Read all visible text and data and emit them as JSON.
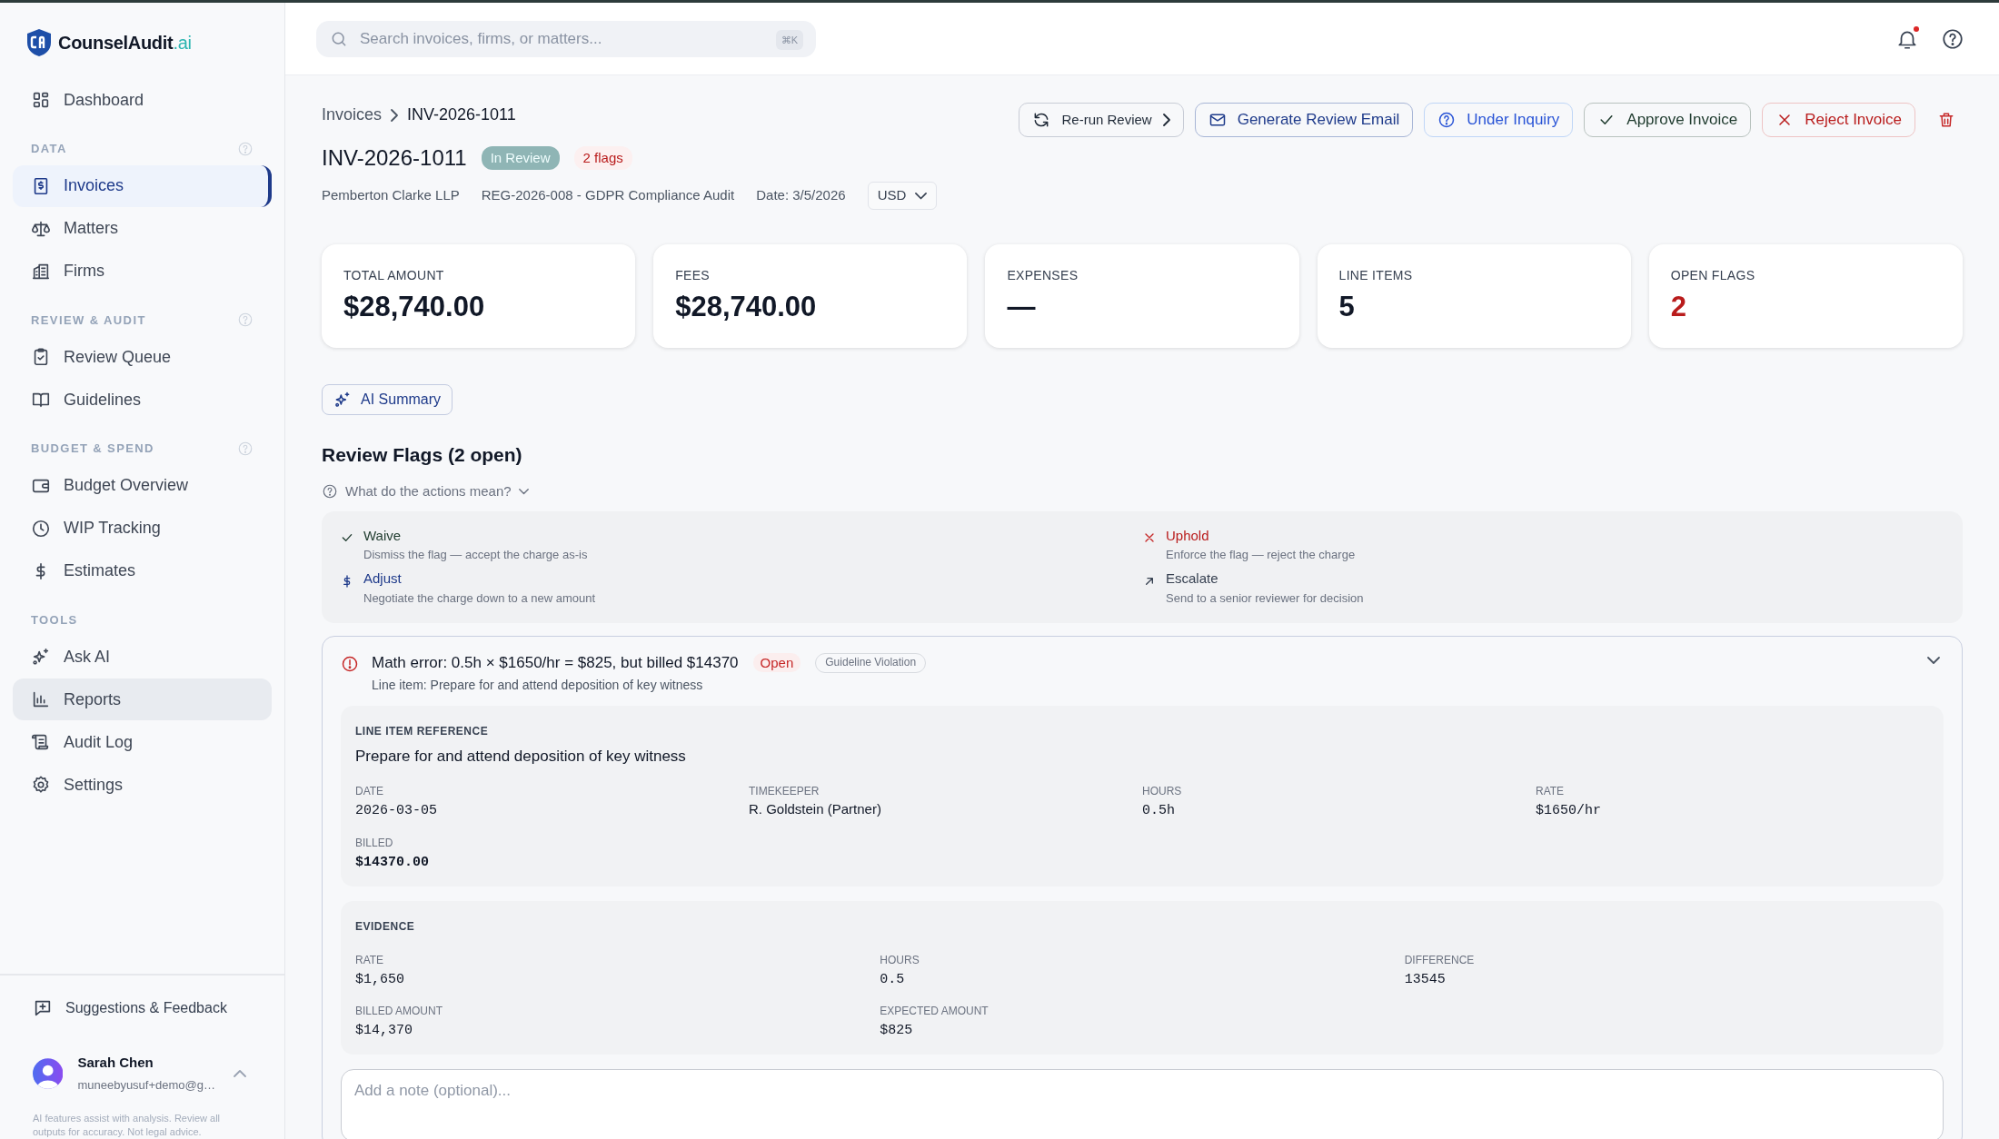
{
  "brand": {
    "name": "CounselAudit",
    "suffix": ".ai"
  },
  "sidebar": {
    "top_items": [
      {
        "label": "Dashboard",
        "selected": false,
        "hovered": false
      }
    ],
    "sections": [
      {
        "title": "DATA",
        "help": true,
        "items": [
          {
            "label": "Invoices",
            "selected": true,
            "hovered": false
          },
          {
            "label": "Matters",
            "selected": false,
            "hovered": false
          },
          {
            "label": "Firms",
            "selected": false,
            "hovered": false
          }
        ]
      },
      {
        "title": "REVIEW & AUDIT",
        "help": true,
        "items": [
          {
            "label": "Review Queue",
            "selected": false,
            "hovered": false
          },
          {
            "label": "Guidelines",
            "selected": false,
            "hovered": false
          }
        ]
      },
      {
        "title": "BUDGET & SPEND",
        "help": true,
        "items": [
          {
            "label": "Budget Overview",
            "selected": false,
            "hovered": false
          },
          {
            "label": "WIP Tracking",
            "selected": false,
            "hovered": false
          },
          {
            "label": "Estimates",
            "selected": false,
            "hovered": false
          }
        ]
      },
      {
        "title": "TOOLS",
        "help": false,
        "items": [
          {
            "label": "Ask AI",
            "selected": false,
            "hovered": false
          },
          {
            "label": "Reports",
            "selected": false,
            "hovered": true
          },
          {
            "label": "Audit Log",
            "selected": false,
            "hovered": false
          },
          {
            "label": "Settings",
            "selected": false,
            "hovered": false
          }
        ]
      }
    ],
    "feedback": "Suggestions & Feedback",
    "user": {
      "name": "Sarah Chen",
      "email": "muneebyusuf+demo@g…"
    },
    "disclaimer": "AI features assist with analysis. Review all outputs for accuracy. Not legal advice."
  },
  "topbar": {
    "search_placeholder": "Search invoices, firms, or matters...",
    "shortcut": "⌘K",
    "notifications_unread": true
  },
  "breadcrumb": [
    "Invoices",
    "INV-2026-1011"
  ],
  "invoice": {
    "number": "INV-2026-1011",
    "status": "In Review",
    "flags_badge": "2 flags",
    "firm": "Pemberton Clarke LLP",
    "matter": "REG-2026-008 - GDPR Compliance Audit",
    "date": "Date: 3/5/2026",
    "currency": "USD"
  },
  "actions": [
    {
      "kind": "rerun",
      "label": "Re-run Review"
    },
    {
      "kind": "email",
      "label": "Generate Review Email"
    },
    {
      "kind": "inquiry",
      "label": "Under Inquiry"
    },
    {
      "kind": "approve",
      "label": "Approve Invoice"
    },
    {
      "kind": "reject",
      "label": "Reject Invoice"
    },
    {
      "kind": "delete"
    }
  ],
  "stats": [
    {
      "label": "TOTAL AMOUNT",
      "value": "$28,740.00",
      "alert": false
    },
    {
      "label": "FEES",
      "value": "$28,740.00",
      "alert": false
    },
    {
      "label": "EXPENSES",
      "value": "—",
      "alert": false
    },
    {
      "label": "LINE ITEMS",
      "value": "5",
      "alert": false
    },
    {
      "label": "OPEN FLAGS",
      "value": "2",
      "alert": true
    }
  ],
  "ai_summary": "AI Summary",
  "flags_heading": "Review Flags (2 open)",
  "legend_toggle": {
    "label": "What do the actions mean?",
    "expanded": true
  },
  "legend": [
    {
      "kind": "waive",
      "title": "Waive",
      "desc": "Dismiss the flag — accept the charge as-is"
    },
    {
      "kind": "uphold",
      "title": "Uphold",
      "desc": "Enforce the flag — reject the charge"
    },
    {
      "kind": "adjust",
      "title": "Adjust",
      "desc": "Negotiate the charge down to a new amount"
    },
    {
      "kind": "escalate",
      "title": "Escalate",
      "desc": "Send to a senior reviewer for decision"
    }
  ],
  "flag": {
    "title": "Math error: 0.5h × $1650/hr = $825, but billed $14370",
    "status": "Open",
    "tag": "Guideline Violation",
    "subtitle": "Line item: Prepare for and attend deposition of key witness",
    "expanded": true,
    "reference": {
      "heading": "LINE ITEM REFERENCE",
      "description": "Prepare for and attend deposition of key witness",
      "fields": [
        {
          "label": "DATE",
          "value": "2026-03-05",
          "kind": "mono"
        },
        {
          "label": "TIMEKEEPER",
          "value": "R. Goldstein (Partner)",
          "kind": "text"
        },
        {
          "label": "HOURS",
          "value": "0.5h",
          "kind": "mono"
        },
        {
          "label": "RATE",
          "value": "$1650/hr",
          "kind": "mono"
        },
        {
          "label": "BILLED",
          "value": "$14370.00",
          "kind": "mono-bold"
        }
      ]
    },
    "evidence": {
      "heading": "EVIDENCE",
      "fields": [
        {
          "label": "RATE",
          "value": "$1,650",
          "kind": "mono"
        },
        {
          "label": "HOURS",
          "value": "0.5",
          "kind": "mono"
        },
        {
          "label": "DIFFERENCE",
          "value": "13545",
          "kind": "mono"
        },
        {
          "label": "BILLED AMOUNT",
          "value": "$14,370",
          "kind": "mono"
        },
        {
          "label": "EXPECTED AMOUNT",
          "value": "$825",
          "kind": "mono"
        }
      ]
    },
    "note_placeholder": "Add a note (optional)..."
  }
}
